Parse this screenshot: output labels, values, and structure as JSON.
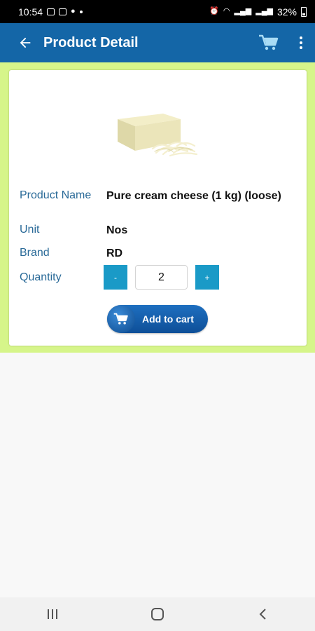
{
  "status_bar": {
    "time": "10:54",
    "battery": "32%"
  },
  "app_bar": {
    "title": "Product Detail"
  },
  "product": {
    "fields": [
      {
        "label": "Product Name",
        "value": "Pure cream cheese (1 kg) (loose)"
      },
      {
        "label": "Unit",
        "value": "Nos"
      },
      {
        "label": "Brand",
        "value": "RD"
      }
    ],
    "quantity_label": "Quantity",
    "quantity_value": "2",
    "decrement_label": "-",
    "increment_label": "+",
    "add_to_cart_label": "Add to cart"
  },
  "colors": {
    "app_bar": "#1466a7",
    "card_border": "#d6f58a",
    "label_text": "#2a6a98",
    "qty_button": "#1a9ac7"
  },
  "icons": [
    "back-arrow-icon",
    "cart-icon",
    "more-vert-icon",
    "recents-icon",
    "home-icon",
    "back-nav-icon"
  ]
}
